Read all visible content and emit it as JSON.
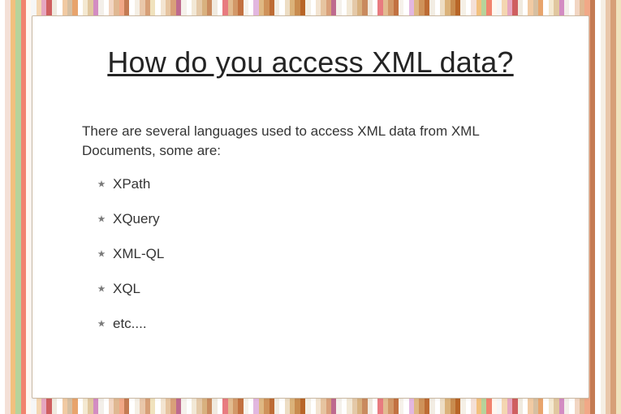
{
  "title": "How do you access XML data?",
  "intro": "There are several languages used to access XML data from XML Documents, some are:",
  "items": [
    "XPath",
    "XQuery",
    "XML-QL",
    "XQL",
    "etc...."
  ],
  "stripe_colors": [
    "#ffffff",
    "#f4e0d7",
    "#f2c07e",
    "#b7d39b",
    "#f1836e",
    "#fff7ef",
    "#f6f6f6",
    "#f4d6b1",
    "#e6a7c0",
    "#cf5f60",
    "#f0eadf",
    "#ffffff",
    "#f1caa3",
    "#d6bfa1",
    "#e8a46c",
    "#ffffff",
    "#f4e9d1",
    "#e1c79f",
    "#d38cc2",
    "#f3efe9",
    "#ffffff",
    "#f2d6c3",
    "#e0b892",
    "#f1a887",
    "#c47b53",
    "#ffffff",
    "#f5efe4",
    "#e9c7aa",
    "#d79f77",
    "#f0e2bd",
    "#ffffff",
    "#f3e4d1",
    "#e6c4a0",
    "#d9a079",
    "#be6a8e",
    "#f5f1eb",
    "#fefefe",
    "#f2e8d6",
    "#e4c9a8",
    "#d8b17f",
    "#c98a5e",
    "#f0eadf",
    "#ffffff",
    "#e87b80",
    "#e2bb90",
    "#d29868",
    "#c27141",
    "#f6f2eb",
    "#ffffff",
    "#e2b7e0",
    "#dfb883",
    "#cf925a",
    "#bd6b34",
    "#f2ede3",
    "#ffffff",
    "#edddc4",
    "#dbb27a",
    "#c98c4f",
    "#b86527",
    "#f5f0e6",
    "#ffffff",
    "#f3e4d1",
    "#e6c4a0",
    "#d9a079",
    "#be6a8e",
    "#f5f1eb",
    "#fefefe",
    "#f2e8d6",
    "#e4c9a8",
    "#d8b17f",
    "#c98a5e",
    "#f0eadf",
    "#ffffff",
    "#e87b80",
    "#e2bb90",
    "#d29868",
    "#c27141",
    "#f6f2eb",
    "#ffffff",
    "#e2b7e0",
    "#dfb883",
    "#cf925a",
    "#bd6b34",
    "#f2ede3",
    "#ffffff",
    "#edddc4",
    "#dbb27a",
    "#c98c4f",
    "#b86527",
    "#f5f0e6",
    "#ffffff",
    "#f4e0d7",
    "#f2c07e",
    "#b7d39b",
    "#f1836e",
    "#fff7ef",
    "#f6f6f6",
    "#f4d6b1",
    "#e6a7c0",
    "#cf5f60",
    "#f0eadf",
    "#ffffff",
    "#f1caa3",
    "#d6bfa1",
    "#e8a46c",
    "#ffffff",
    "#f4e9d1",
    "#e1c79f",
    "#d38cc2",
    "#f3efe9",
    "#ffffff",
    "#f2d6c3",
    "#e0b892",
    "#f1a887",
    "#c47b53",
    "#ffffff",
    "#f5efe4",
    "#e9c7aa",
    "#d79f77",
    "#f0e2bd"
  ]
}
